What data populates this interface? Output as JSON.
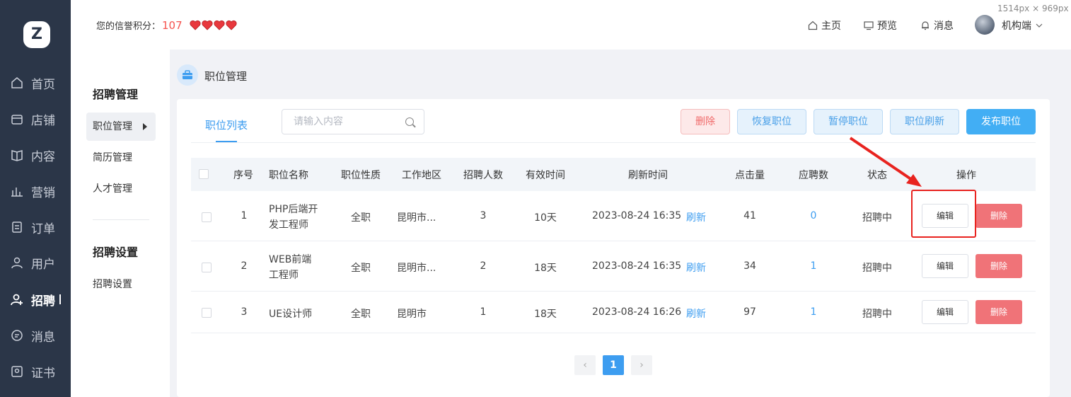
{
  "sidebar": {
    "logo": "Z",
    "items": [
      {
        "label": "首页",
        "icon": "home-icon"
      },
      {
        "label": "店铺",
        "icon": "store-icon"
      },
      {
        "label": "内容",
        "icon": "book-icon"
      },
      {
        "label": "营销",
        "icon": "chart-icon"
      },
      {
        "label": "订单",
        "icon": "order-icon"
      },
      {
        "label": "用户",
        "icon": "user-icon"
      },
      {
        "label": "招聘",
        "icon": "recruit-icon",
        "active": true
      },
      {
        "label": "消息",
        "icon": "message-icon"
      },
      {
        "label": "证书",
        "icon": "certificate-icon"
      }
    ]
  },
  "header": {
    "credit_label": "您的信誉积分：",
    "credit_score": "107",
    "hearts": 4,
    "links": [
      {
        "label": "主页",
        "icon": "home-icon"
      },
      {
        "label": "预览",
        "icon": "monitor-icon"
      },
      {
        "label": "消息",
        "icon": "bell-icon"
      }
    ],
    "user": "机构端",
    "size_note": "1514px × 969px"
  },
  "submenu": {
    "group1_title": "招聘管理",
    "group1_items": [
      "职位管理",
      "简历管理",
      "人才管理"
    ],
    "group2_title": "招聘设置",
    "group2_items": [
      "招聘设置"
    ]
  },
  "breadcrumb": {
    "title": "职位管理"
  },
  "main": {
    "tab": "职位列表",
    "search_placeholder": "请输入内容",
    "actions": {
      "delete": "删除",
      "restore": "恢复职位",
      "pause": "暂停职位",
      "refresh": "职位刷新",
      "publish": "发布职位"
    }
  },
  "table": {
    "headers": [
      "序号",
      "职位名称",
      "职位性质",
      "工作地区",
      "招聘人数",
      "有效时间",
      "刷新时间",
      "点击量",
      "应聘数",
      "状态",
      "操作"
    ],
    "rows": [
      {
        "no": "1",
        "name_l1": "PHP后端开",
        "name_l2": "发工程师",
        "type": "全职",
        "area": "昆明市...",
        "count": "3",
        "valid": "10天",
        "refresh_time": "2023-08-24 16:35",
        "refresh_link": "刷新",
        "clicks": "41",
        "applies": "0",
        "status": "招聘中",
        "edit": "编辑",
        "delete": "删除"
      },
      {
        "no": "2",
        "name_l1": "WEB前端",
        "name_l2": "工程师",
        "type": "全职",
        "area": "昆明市...",
        "count": "2",
        "valid": "18天",
        "refresh_time": "2023-08-24 16:35",
        "refresh_link": "刷新",
        "clicks": "34",
        "applies": "1",
        "status": "招聘中",
        "edit": "编辑",
        "delete": "删除"
      },
      {
        "no": "3",
        "name_l1": "UE设计师",
        "name_l2": "",
        "type": "全职",
        "area": "昆明市",
        "count": "1",
        "valid": "18天",
        "refresh_time": "2023-08-24 16:26",
        "refresh_link": "刷新",
        "clicks": "97",
        "applies": "1",
        "status": "招聘中",
        "edit": "编辑",
        "delete": "删除"
      }
    ]
  },
  "pagination": {
    "prev": "‹",
    "current": "1",
    "next": "›"
  },
  "colors": {
    "accent": "#3d9df0",
    "danger": "#f07378",
    "sidebar_bg": "#2b3648",
    "annotation": "#e8231f"
  }
}
